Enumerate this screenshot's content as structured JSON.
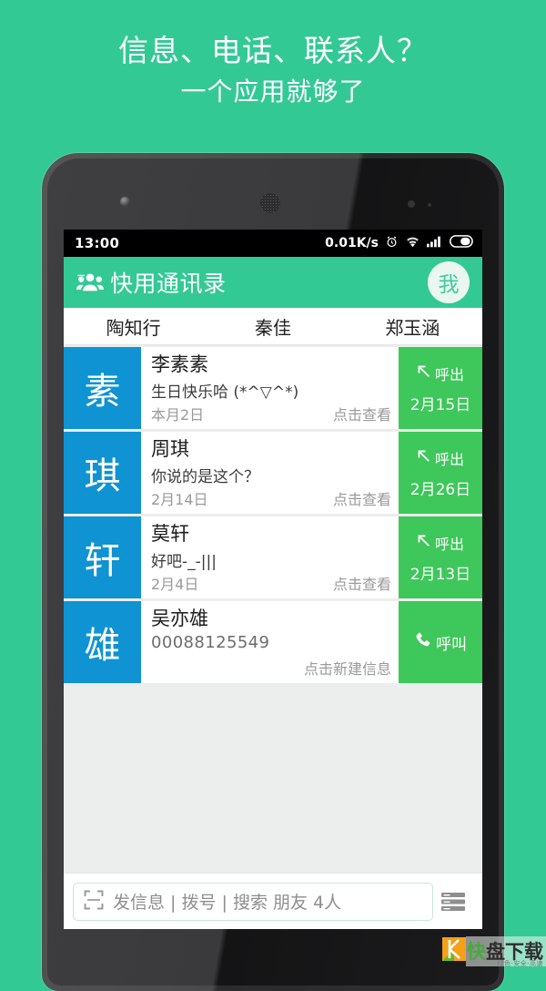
{
  "promo": {
    "line1": "信息、电话、联系人？",
    "line2": "一个应用就够了"
  },
  "colors": {
    "background_green": "#33c994",
    "appbar_green": "#33c994",
    "avatar_blue": "#0f93d2",
    "action_green": "#3ec75a",
    "list_background": "#eceded"
  },
  "statusbar": {
    "time": "13:00",
    "network_speed": "0.01K/s",
    "icons": [
      "alarm-icon",
      "wifi-icon",
      "signal-icon",
      "battery-icon"
    ]
  },
  "appbar": {
    "icon": "contacts-group-icon",
    "title": "快用通讯录",
    "avatar_label": "我"
  },
  "tabs": [
    {
      "label": "陶知行"
    },
    {
      "label": "秦佳"
    },
    {
      "label": "郑玉涵"
    }
  ],
  "list": [
    {
      "avatar": "素",
      "name": "李素素",
      "message": "生日快乐哈 (*^▽^*)",
      "date": "本月2日",
      "hint": "点击查看",
      "action_icon": "call-outgoing-arrow-icon",
      "action_label": "呼出",
      "action_date": "2月15日"
    },
    {
      "avatar": "琪",
      "name": "周琪",
      "message": "你说的是这个？",
      "date": "2月14日",
      "hint": "点击查看",
      "action_icon": "call-outgoing-arrow-icon",
      "action_label": "呼出",
      "action_date": "2月26日"
    },
    {
      "avatar": "轩",
      "name": "莫轩",
      "message": "好吧-_-|||",
      "date": "2月4日",
      "hint": "点击查看",
      "action_icon": "call-outgoing-arrow-icon",
      "action_label": "呼出",
      "action_date": "2月13日"
    },
    {
      "avatar": "雄",
      "name": "吴亦雄",
      "message": "00088125549",
      "date": "",
      "hint": "点击新建信息",
      "action_icon": "phone-handset-icon",
      "action_label": "呼叫",
      "action_date": ""
    }
  ],
  "bottombar": {
    "scan_icon": "scan-frame-icon",
    "search_placeholder": "发信息 | 拨号 | 搜索 朋友 4人",
    "menu_icon": "list-view-icon"
  },
  "watermark": {
    "logo": "K",
    "brand_first": "快",
    "brand_rest": "盘下载",
    "tagline": "绿色·安全·高速"
  }
}
